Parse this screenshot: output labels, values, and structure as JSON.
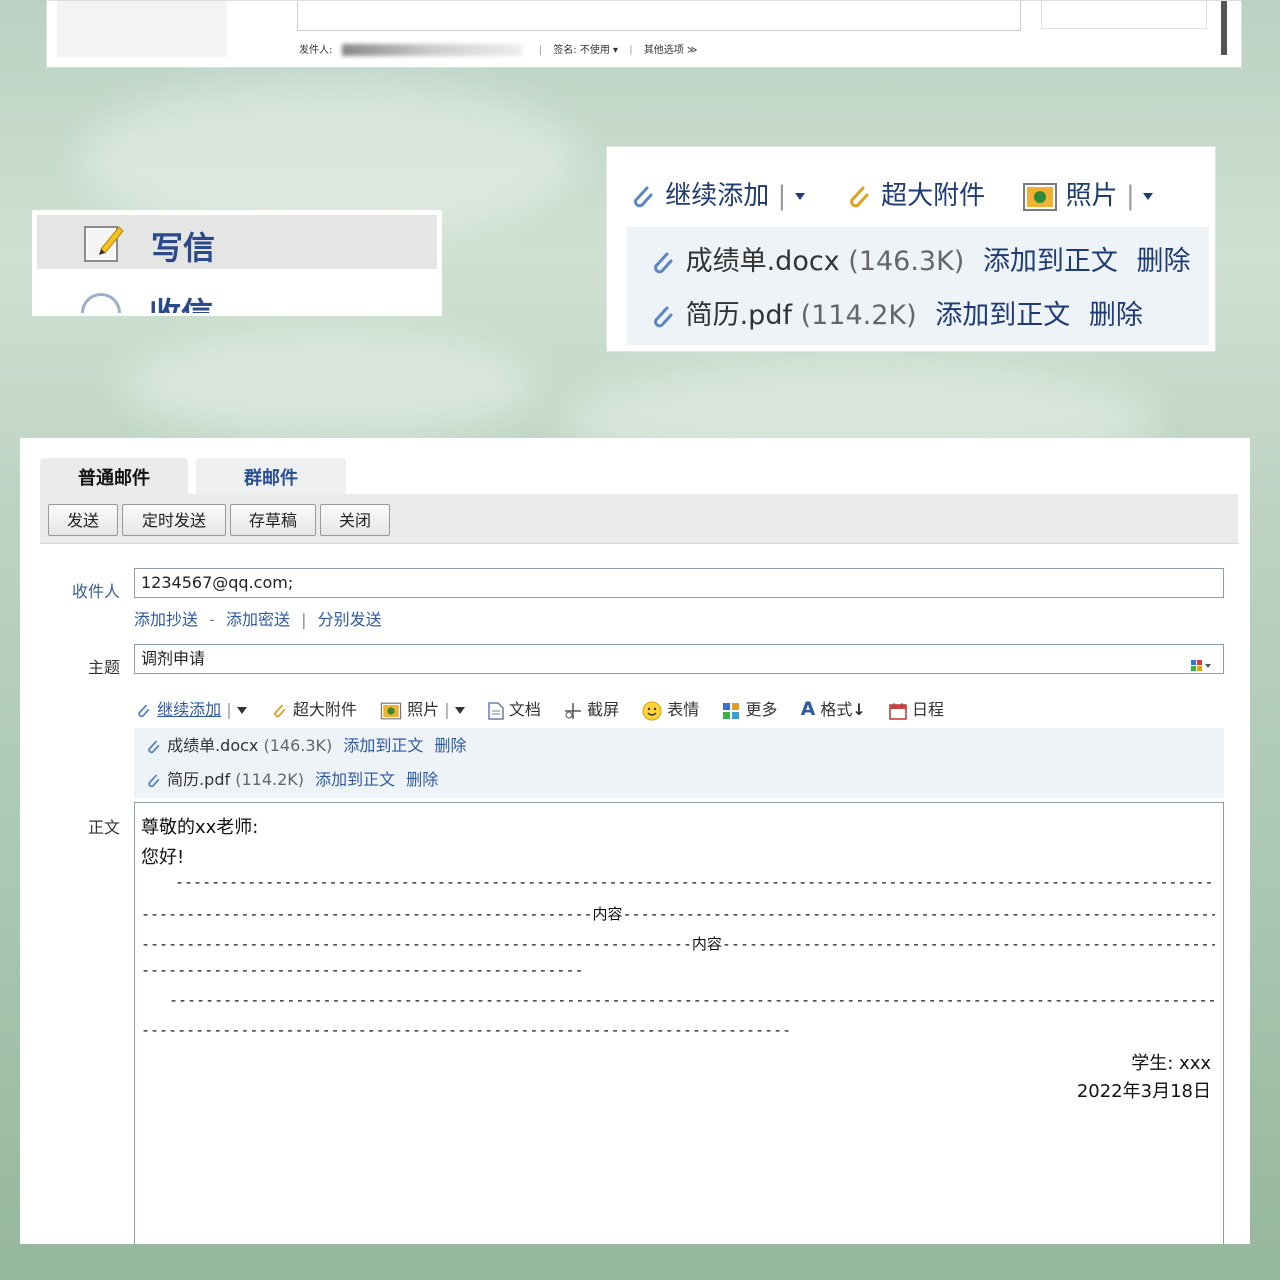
{
  "top_strip": {
    "sender_label": "发件人:",
    "signature_label": "签名: 不使用 ▾",
    "other_options": "其他选项 ≫"
  },
  "nav": {
    "write": "写信",
    "receive": "收信"
  },
  "zoom_attachments": {
    "toolbar": {
      "continue_add": "继续添加",
      "large_attachment": "超大附件",
      "photo": "照片"
    },
    "files": [
      {
        "name": "成绩单.docx",
        "size": "(146.3K)",
        "add_to_body": "添加到正文",
        "delete": "删除"
      },
      {
        "name": "简历.pdf",
        "size": "(114.2K)",
        "add_to_body": "添加到正文",
        "delete": "删除"
      }
    ]
  },
  "compose": {
    "tabs": [
      "普通邮件",
      "群邮件"
    ],
    "buttons": [
      "发送",
      "定时发送",
      "存草稿",
      "关闭"
    ],
    "to_label": "收件人",
    "to_value": "1234567@qq.com;",
    "cc_links": {
      "add_cc": "添加抄送",
      "dash": "-",
      "add_bcc": "添加密送",
      "pipe": "|",
      "separate": "分别发送"
    },
    "subject_label": "主题",
    "subject_value": "调剂申请",
    "toolbar": {
      "continue_add": "继续添加",
      "large_attachment": "超大附件",
      "photo": "照片",
      "document": "文档",
      "screenshot": "截屏",
      "emoji": "表情",
      "more": "更多",
      "format": "格式",
      "schedule": "日程"
    },
    "attachments": [
      {
        "name": "成绩单.docx",
        "size": "(146.3K)",
        "add_to_body": "添加到正文",
        "delete": "删除"
      },
      {
        "name": "简历.pdf",
        "size": "(114.2K)",
        "add_to_body": "添加到正文",
        "delete": "删除"
      }
    ],
    "body_label": "正文",
    "body": {
      "greeting": "尊敬的xx老师:",
      "hello": "您好!",
      "dash_line_1": "---------------------------------------------------------------------------------------------------------------------------------------------------",
      "content_line_1": "--------------------------------------------------内容--------------------------------------------------------------------------------------",
      "content_line_2": "-------------------------------------------------------------内容-------------------------------------------------------------------------",
      "dash_line_2": "----------------------------------------------------------",
      "dash_line_3": "-----------------------------------------------------------------------------------------------------------------------------------------------------",
      "dash_line_4": "--------------------------------------------------------------------------------------",
      "signature_student": "学生: xxx",
      "signature_date": "2022年3月18日"
    }
  },
  "colors": {
    "link_blue": "#2f5aa0",
    "nav_blue": "#2b4a8a",
    "toolbar_gray": "#ebebeb",
    "attachment_bg": "#eef3f8"
  }
}
